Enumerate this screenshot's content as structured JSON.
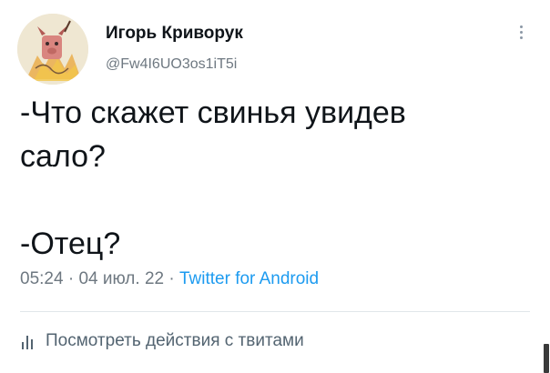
{
  "author": {
    "display_name": "Игорь Криворук",
    "handle": "@Fw4I6UO3os1iT5i",
    "avatar_icon": "cartoon-pig-avatar-icon"
  },
  "tweet": {
    "lines": [
      "-Что скажет свинья увидев",
      "сало?",
      "",
      "-Отец?"
    ]
  },
  "meta": {
    "time": "05:24",
    "separator": "·",
    "date": "04 июл. 22",
    "source": "Twitter for Android"
  },
  "actions": {
    "view_activity_label": "Посмотреть действия с твитами",
    "activity_icon": "bar-chart-icon",
    "more_icon": "more-vertical-icon"
  },
  "colors": {
    "text": "#0f1419",
    "secondary": "#6e7881",
    "link": "#1d9bf0"
  }
}
